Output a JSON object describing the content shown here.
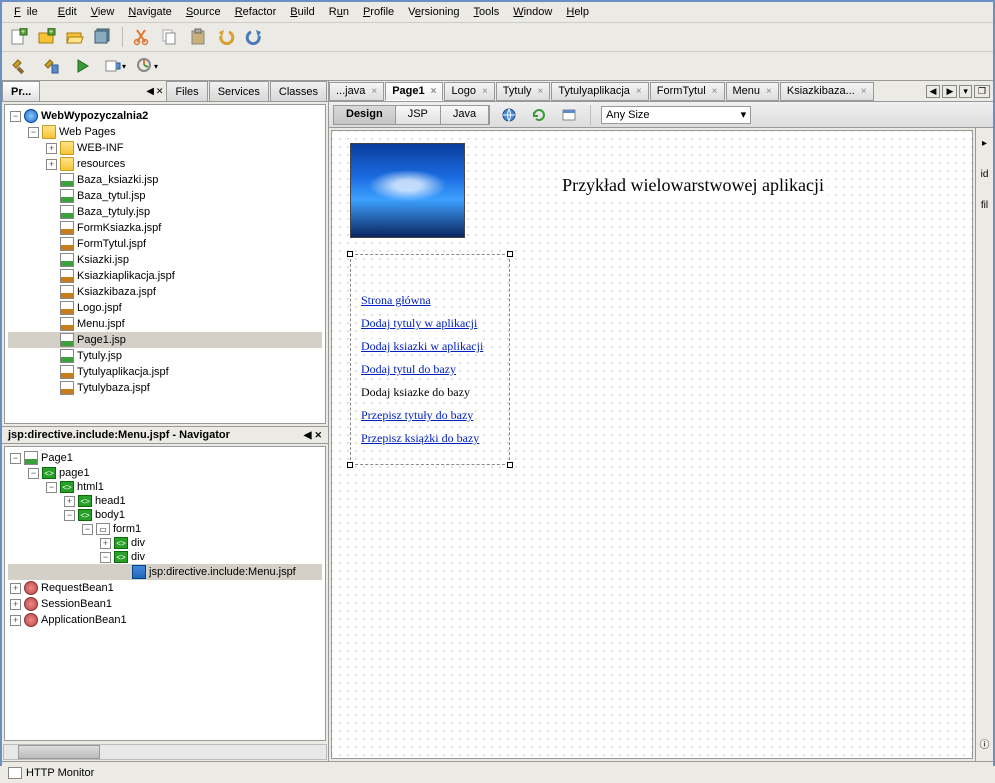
{
  "menu": {
    "file": "File",
    "edit": "Edit",
    "view": "View",
    "navigate": "Navigate",
    "source": "Source",
    "refactor": "Refactor",
    "build": "Build",
    "run": "Run",
    "profile": "Profile",
    "versioning": "Versioning",
    "tools": "Tools",
    "window": "Window",
    "help": "Help"
  },
  "left_tabs": {
    "projects": "Pr...",
    "files": "Files",
    "services": "Services",
    "classes": "Classes"
  },
  "project_tree": {
    "root": "WebWypozyczalnia2",
    "webpages": "Web Pages",
    "webinf": "WEB-INF",
    "resources": "resources",
    "files": [
      "Baza_ksiazki.jsp",
      "Baza_tytul.jsp",
      "Baza_tytuly.jsp",
      "FormKsiazka.jspf",
      "FormTytul.jspf",
      "Ksiazki.jsp",
      "Ksiazkiaplikacja.jspf",
      "Ksiazkibaza.jspf",
      "Logo.jspf",
      "Menu.jspf",
      "Page1.jsp",
      "Tytuly.jsp",
      "Tytulyaplikacja.jspf",
      "Tytulybaza.jspf"
    ]
  },
  "navigator": {
    "title": "jsp:directive.include:Menu.jspf - Navigator",
    "nodes": {
      "page": "Page1",
      "page1": "page1",
      "html1": "html1",
      "head1": "head1",
      "body1": "body1",
      "form1": "form1",
      "div1": "div",
      "div2": "div",
      "include": "jsp:directive.include:Menu.jspf",
      "rb": "RequestBean1",
      "sb": "SessionBean1",
      "ab": "ApplicationBean1"
    }
  },
  "editor_tabs": [
    "...java",
    "Page1",
    "Logo",
    "Tytuly",
    "Tytulyaplikacja",
    "FormTytul",
    "Menu",
    "Ksiazkibaza..."
  ],
  "view_tabs": {
    "design": "Design",
    "jsp": "JSP",
    "java": "Java"
  },
  "size_select": "Any Size",
  "canvas": {
    "title": "Przykład wielowarstwowej aplikacji",
    "links": [
      "Strona główna",
      "Dodaj tytuly w aplikacji",
      "Dodaj ksiazki w aplikacji",
      "Dodaj tytul do bazy",
      "Dodaj ksiazke do bazy",
      "Przepisz tytuły do bazy",
      "Przepisz książki do bazy"
    ]
  },
  "status": {
    "http": "HTTP Monitor"
  },
  "right_sidebar": {
    "id": "id",
    "fil": "fil"
  }
}
